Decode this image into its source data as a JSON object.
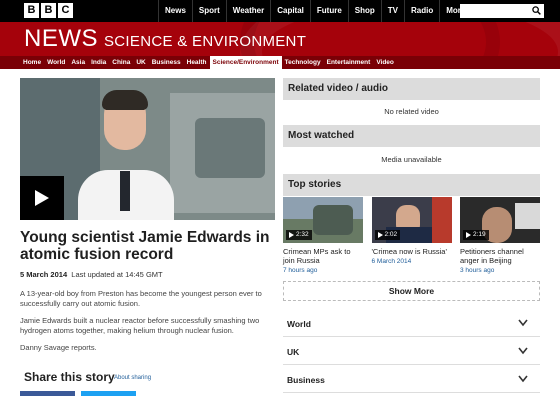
{
  "global_nav": {
    "logo_letters": [
      "B",
      "B",
      "C"
    ],
    "items": [
      "News",
      "Sport",
      "Weather",
      "Capital",
      "Future",
      "Shop",
      "TV",
      "Radio",
      "More..."
    ],
    "search_placeholder": ""
  },
  "banner": {
    "news": "NEWS",
    "section": "SCIENCE & ENVIRONMENT",
    "color": "#a5020b"
  },
  "subnav": {
    "items": [
      "Home",
      "World",
      "Asia",
      "India",
      "China",
      "UK",
      "Business",
      "Health",
      "Science/Environment",
      "Technology",
      "Entertainment",
      "Video"
    ],
    "active_index": 8
  },
  "article": {
    "headline": "Young scientist Jamie Edwards in atomic fusion record",
    "date": "5 March 2014",
    "updated": "Last updated at 14:45 GMT",
    "paragraphs": [
      "A 13-year-old boy from Preston has become the youngest person ever to successfully carry out atomic fusion.",
      "Jamie Edwards built a nuclear reactor before successfully smashing two hydrogen atoms together, making helium through nuclear fusion.",
      "Danny Savage reports."
    ],
    "share_title": "Share this story",
    "share_link": "About sharing"
  },
  "sidebar": {
    "related": {
      "title": "Related video / audio",
      "body": "No related video"
    },
    "most_watched": {
      "title": "Most watched",
      "body": "Media unavailable"
    },
    "top_stories": {
      "title": "Top stories",
      "items": [
        {
          "duration": "2:32",
          "title": "Crimean MPs ask to join Russia",
          "time": "7 hours ago"
        },
        {
          "duration": "2:02",
          "title": "'Crimea now is Russia'",
          "time": "6 March 2014"
        },
        {
          "duration": "2:19",
          "title": "Petitioners channel anger in Beijing",
          "time": "3 hours ago"
        }
      ],
      "show_more": "Show More"
    },
    "accordion": [
      "World",
      "UK",
      "Business"
    ]
  }
}
